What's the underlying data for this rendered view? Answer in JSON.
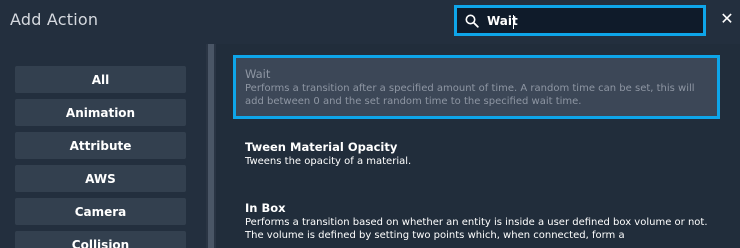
{
  "header": {
    "title": "Add Action",
    "search_value": "Wait",
    "close_glyph": "✕",
    "accent_color": "#0ea5e9"
  },
  "sidebar": {
    "categories": [
      "All",
      "Animation",
      "Attribute",
      "AWS",
      "Camera",
      "Collision"
    ]
  },
  "results": [
    {
      "title": "Wait",
      "description": "Performs a transition after a specified amount of time. A random time can be set, this will add between 0 and the set random time to the specified wait time.",
      "selected": true
    },
    {
      "title": "Tween Material Opacity",
      "description": "Tweens the opacity of a material.",
      "selected": false
    },
    {
      "title": "In Box",
      "description": "Performs a transition based on whether an entity is inside a user defined box volume or not. The volume is defined by setting two points which, when connected, form a",
      "selected": false
    }
  ]
}
